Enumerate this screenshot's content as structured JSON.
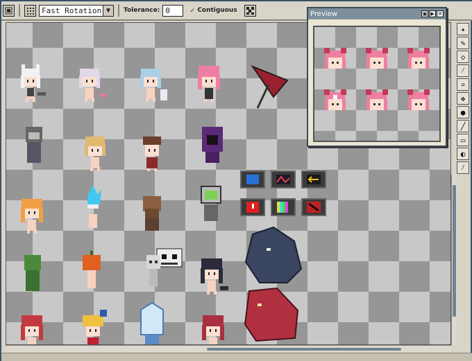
{
  "toolbar": {
    "rotation_mode": "Fast Rotation",
    "tolerance_label": "Tolerance:",
    "tolerance_value": "0",
    "contiguous_label": "Contiguous",
    "contiguous_checked": true,
    "icons": [
      "grid-icon",
      "dropdown-arrow-icon",
      "check-icon",
      "tile-pattern-icon"
    ]
  },
  "preview": {
    "title": "Preview",
    "buttons": [
      "dock-icon",
      "play-icon",
      "close-icon"
    ]
  },
  "tools": [
    "magic-wand-icon",
    "pencil-icon",
    "eraser-icon",
    "eyedropper-icon",
    "zoom-icon",
    "move-icon",
    "fill-bucket-icon",
    "line-icon",
    "rectangle-icon",
    "ellipse-icon",
    "brush-icon"
  ],
  "colors": {
    "frame": "#2a3b49",
    "chrome": "#d8d4c8",
    "checker_light": "#c8c8c8",
    "checker_dark": "#969696",
    "title_bar": "#7d8f9c",
    "scroll_thumb": "#6f8392"
  }
}
